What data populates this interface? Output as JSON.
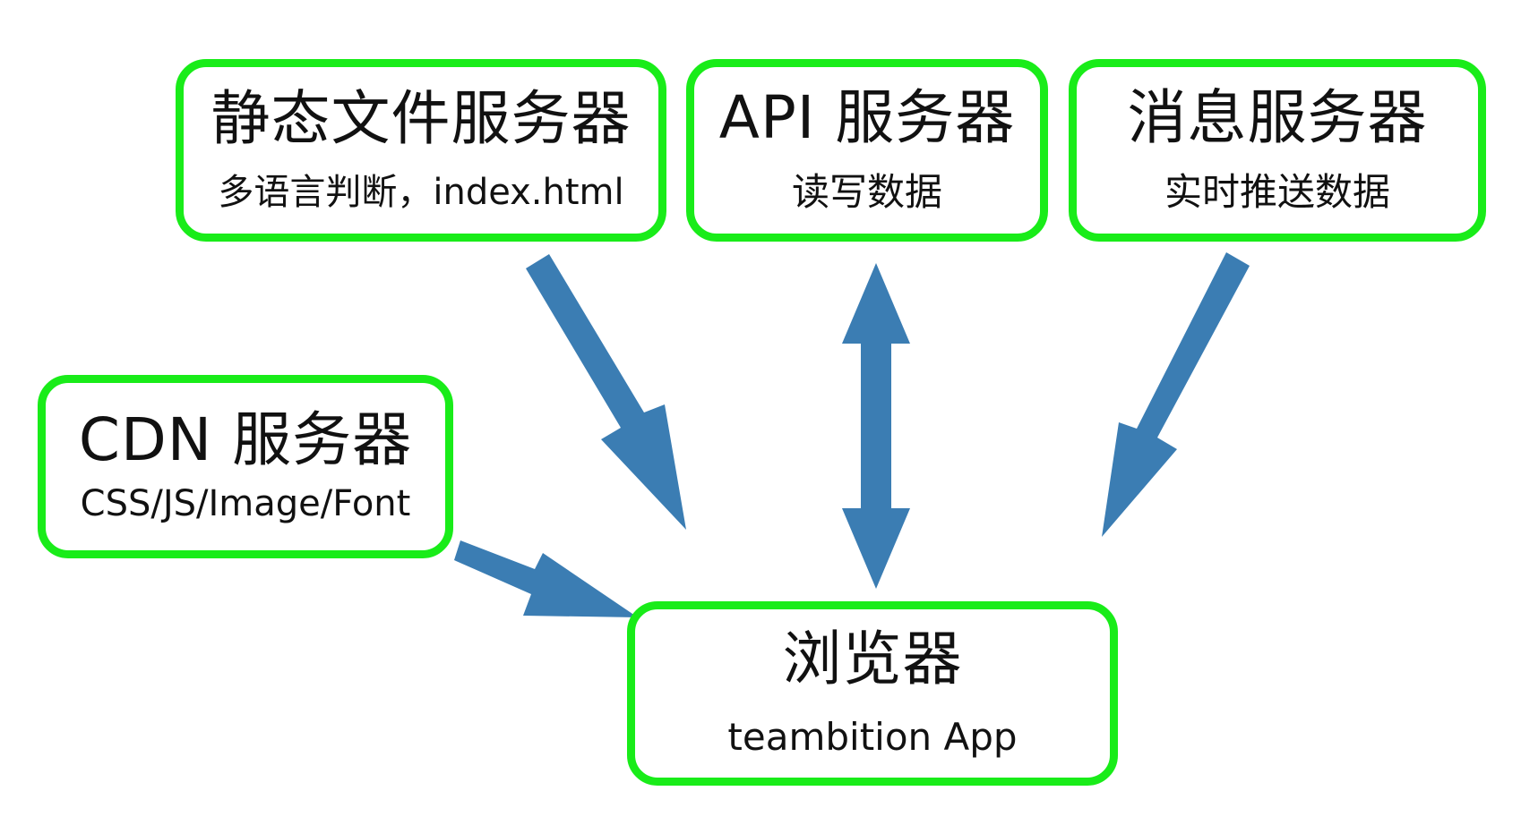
{
  "colors": {
    "node_border": "#19ec19",
    "arrow_fill": "#3b7db3",
    "text": "#111111",
    "background": "#ffffff"
  },
  "nodes": {
    "static_server": {
      "title": "静态文件服务器",
      "subtitle": "多语言判断，index.html"
    },
    "api_server": {
      "title": "API 服务器",
      "subtitle": "读写数据"
    },
    "message_server": {
      "title": "消息服务器",
      "subtitle": "实时推送数据"
    },
    "cdn_server": {
      "title": "CDN 服务器",
      "subtitle": "CSS/JS/Image/Font"
    },
    "browser": {
      "title": "浏览器",
      "subtitle": "teambition App"
    }
  },
  "edges": [
    {
      "from": "静态文件服务器",
      "to": "浏览器",
      "direction": "one-way"
    },
    {
      "from": "API 服务器",
      "to": "浏览器",
      "direction": "two-way"
    },
    {
      "from": "消息服务器",
      "to": "浏览器",
      "direction": "one-way"
    },
    {
      "from": "CDN 服务器",
      "to": "浏览器",
      "direction": "one-way"
    }
  ]
}
